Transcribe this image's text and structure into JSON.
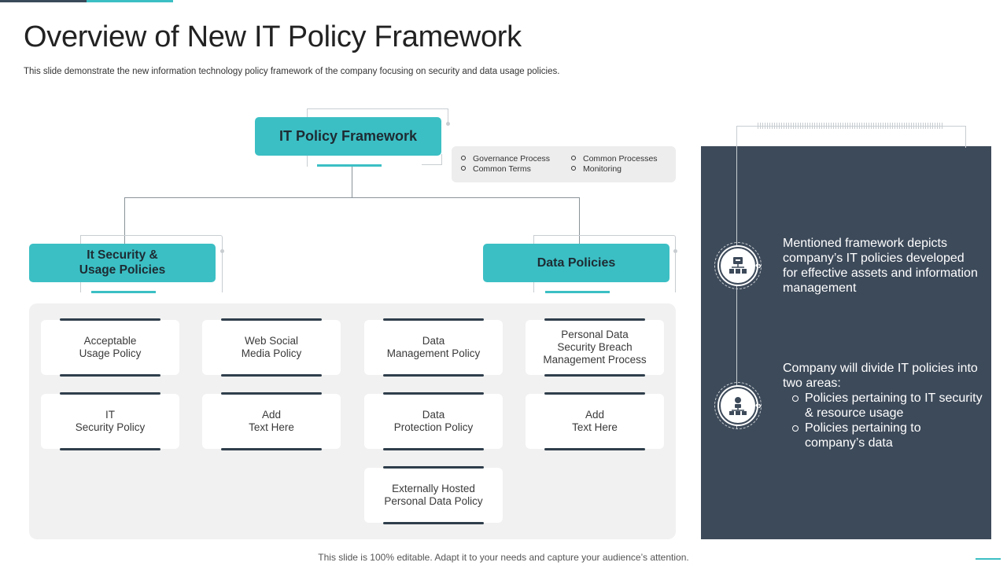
{
  "slide": {
    "title": "Overview of New IT Policy Framework",
    "subtitle": "This slide demonstrate the new information technology policy framework of the company focusing on security and data usage policies.",
    "footer": "This slide is 100% editable. Adapt it to your needs and capture your audience’s attention."
  },
  "framework": {
    "root_label": "IT Policy Framework",
    "tags": [
      "Governance Process",
      "Common Processes",
      "Common Terms",
      "Monitoring"
    ],
    "branches": [
      {
        "label": "It Security &\nUsage Policies",
        "policies": [
          "Acceptable\nUsage Policy",
          "Web Social\nMedia Policy",
          "IT\nSecurity Policy",
          "Add\nText Here"
        ]
      },
      {
        "label": "Data Policies",
        "policies": [
          "Data\nManagement Policy",
          "Personal Data\nSecurity Breach\nManagement Process",
          "Data\nProtection Policy",
          "Add\nText Here",
          "Externally Hosted\nPersonal Data Policy"
        ]
      }
    ]
  },
  "side_panel": {
    "point1": "Mentioned framework depicts company’s IT policies developed for effective assets and information management",
    "point2_intro": "Company will divide IT policies into two areas:",
    "point2_items": [
      "Policies pertaining to IT security & resource usage",
      "Policies pertaining to company’s data"
    ],
    "icons": [
      "framework-icon",
      "network-icon"
    ]
  },
  "colors": {
    "accent": "#3bbfc4",
    "dark": "#3d4a5a",
    "panel_bg": "#f1f1f1"
  }
}
